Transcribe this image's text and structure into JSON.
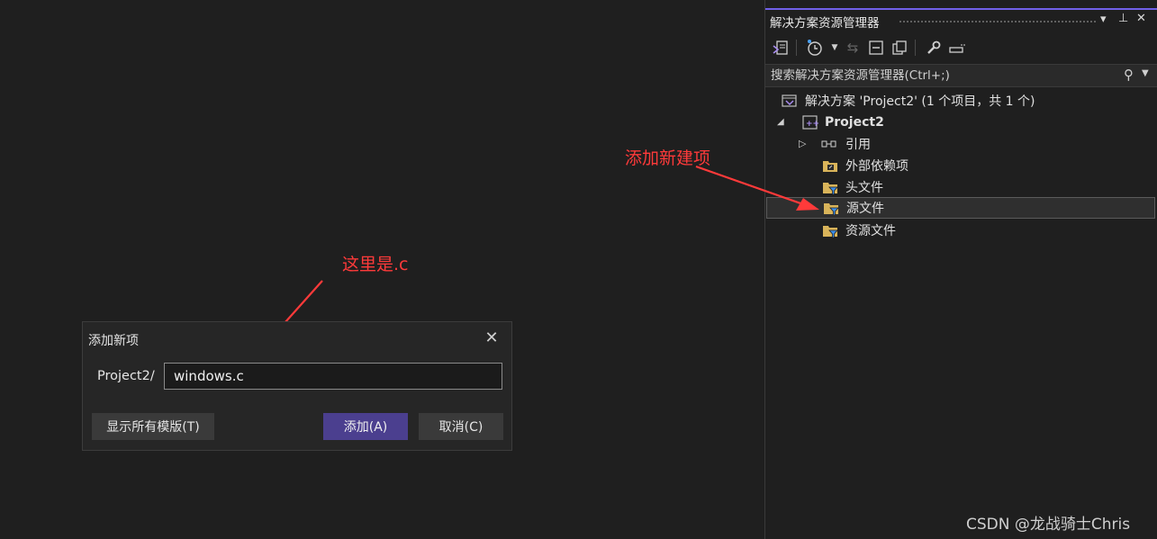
{
  "solution_explorer": {
    "title": "解决方案资源管理器",
    "title_buttons": {
      "dropdown": "▾",
      "pin": "⊥",
      "close": "✕"
    },
    "search_placeholder": "搜索解决方案资源管理器(Ctrl+;)",
    "tree": {
      "solution": "解决方案 'Project2' (1 个项目，共 1 个)",
      "project": "Project2",
      "items": {
        "references": "引用",
        "external_deps": "外部依赖项",
        "header_files": "头文件",
        "source_files": "源文件",
        "resource_files": "资源文件"
      }
    }
  },
  "annotations": {
    "add_new_item": "添加新建项",
    "here_is_c": "这里是.c"
  },
  "dialog": {
    "title": "添加新项",
    "path_prefix": "Project2/",
    "filename_value": "windows.c",
    "show_templates_label": "显示所有模版(T)",
    "add_label": "添加(A)",
    "cancel_label": "取消(C)"
  },
  "watermark": "CSDN @龙战骑士Chris",
  "colors": {
    "accent": "#7160e8",
    "annotation": "#ff3a3a",
    "primary_button": "#4b3f8f",
    "background": "#1f1f1f"
  }
}
